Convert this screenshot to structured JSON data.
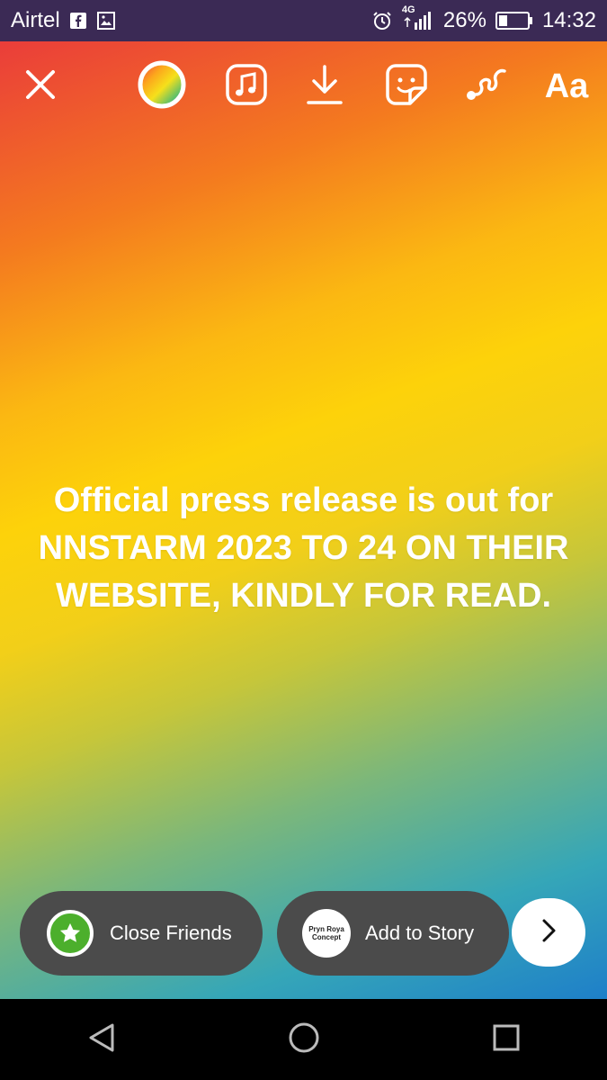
{
  "status_bar": {
    "carrier": "Airtel",
    "network": "4G",
    "battery_percent": "26%",
    "time": "14:32",
    "icons": [
      "facebook-icon",
      "gallery-icon",
      "alarm-icon",
      "signal-icon",
      "battery-icon"
    ]
  },
  "toolbar": {
    "close_icon": "close-icon",
    "color_icon": "color-wheel-icon",
    "music_icon": "music-icon",
    "download_icon": "download-icon",
    "sticker_icon": "sticker-icon",
    "draw_icon": "draw-icon",
    "text_tool_label": "Aa"
  },
  "story": {
    "text": "Official press release is out for NNSTARM 2023 TO 24 ON THEIR WEBSITE, KINDLY FOR READ.",
    "colors": {
      "gradient": [
        "#ea3d3a",
        "#f47a1f",
        "#fdd20a",
        "#7cb77a",
        "#1e7fc9"
      ],
      "text": "#ffffff"
    }
  },
  "actions": {
    "close_friends_label": "Close Friends",
    "add_to_story_label": "Add to Story",
    "avatar_text_line1": "Pryn Roya",
    "avatar_text_line2": "Concept",
    "close_friends_color": "#4caf2c"
  },
  "nav": {
    "back_icon": "back-triangle-icon",
    "home_icon": "home-circle-icon",
    "recents_icon": "recents-square-icon"
  }
}
